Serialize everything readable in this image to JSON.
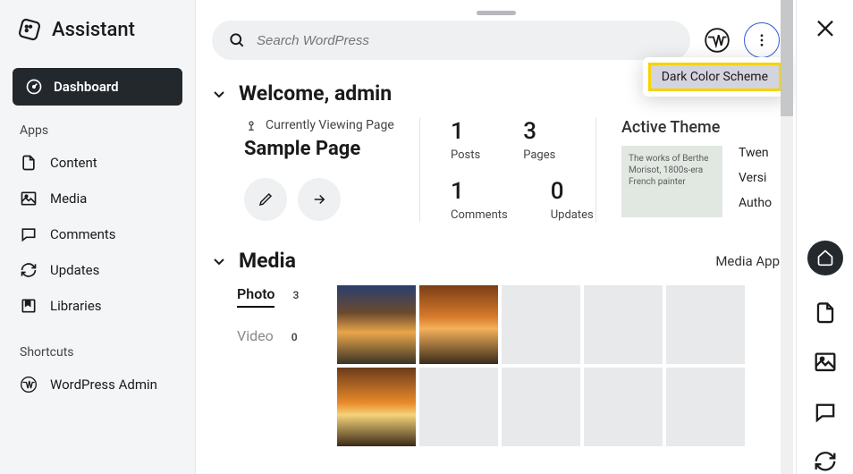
{
  "brand": {
    "title": "Assistant"
  },
  "nav": {
    "active": "Dashboard",
    "apps_label": "Apps",
    "items": [
      "Content",
      "Media",
      "Comments",
      "Updates",
      "Libraries"
    ],
    "shortcuts_label": "Shortcuts",
    "shortcuts": [
      "WordPress Admin"
    ]
  },
  "search": {
    "placeholder": "Search WordPress"
  },
  "tooltip": {
    "text": "Dark Color Scheme"
  },
  "welcome": {
    "heading": "Welcome, admin",
    "viewing_label": "Currently Viewing Page",
    "page_name": "Sample Page",
    "stats": {
      "posts": {
        "value": "1",
        "label": "Posts"
      },
      "pages": {
        "value": "3",
        "label": "Pages"
      },
      "comments": {
        "value": "1",
        "label": "Comments"
      },
      "updates": {
        "value": "0",
        "label": "Updates"
      }
    },
    "theme": {
      "header": "Active Theme",
      "thumb_text": "The works of Berthe Morisot, 1800s-era French painter",
      "name_partial": "Twen",
      "version_label": "Versi",
      "author_label": "Autho"
    }
  },
  "media": {
    "heading": "Media",
    "app_link": "Media App",
    "filters": {
      "photo": {
        "label": "Photo",
        "count": "3"
      },
      "video": {
        "label": "Video",
        "count": "0"
      }
    }
  }
}
